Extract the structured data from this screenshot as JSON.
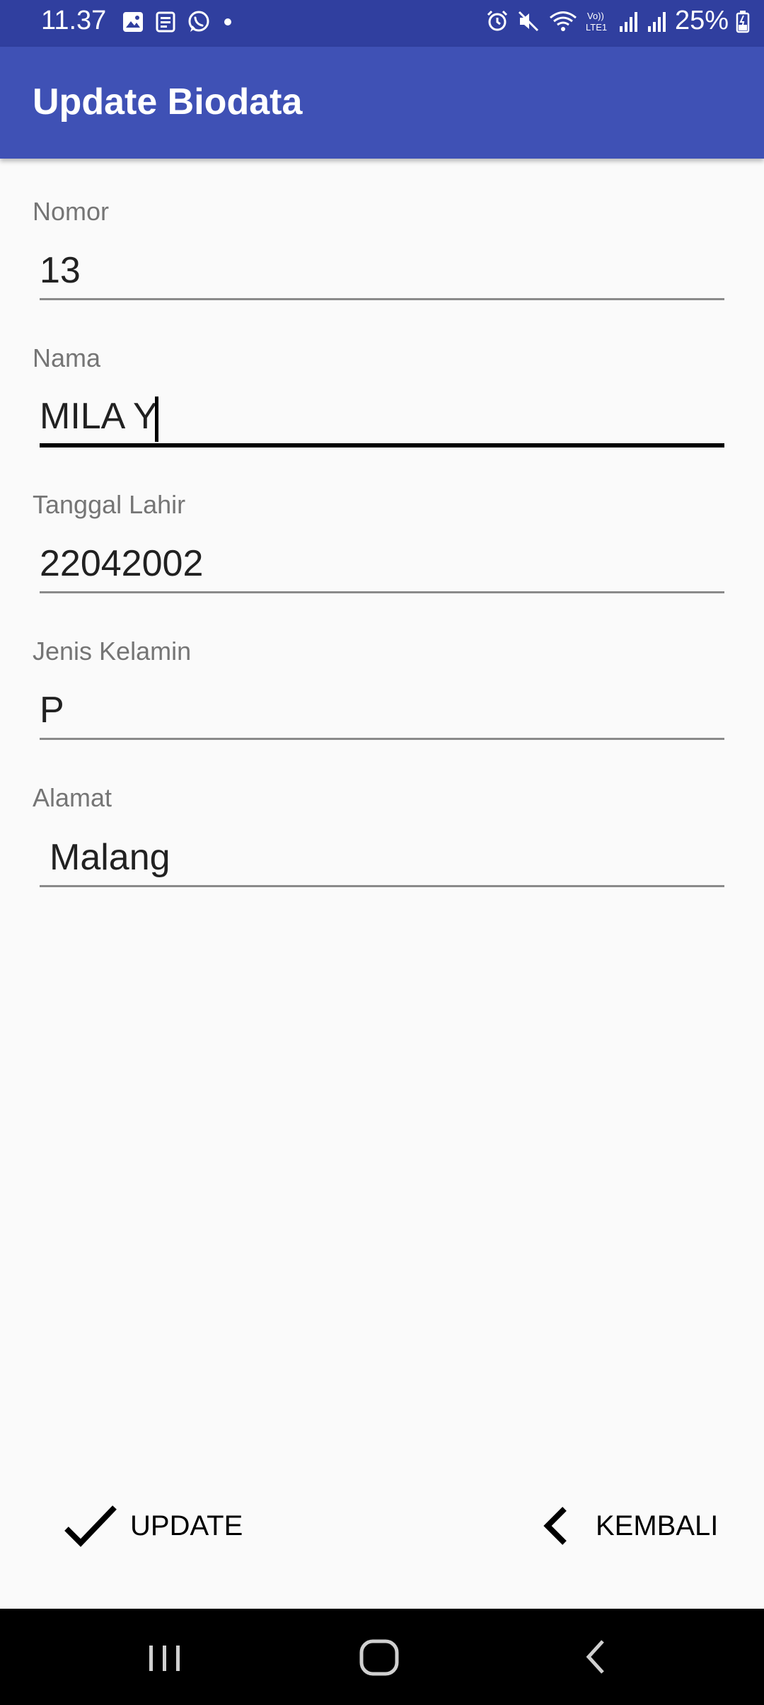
{
  "status_bar": {
    "time": "11.37",
    "battery": "25%",
    "left_icons": [
      "image-icon",
      "news-icon",
      "whatsapp-icon",
      "dot-icon"
    ],
    "right_icons": [
      "alarm-icon",
      "mute-icon",
      "wifi-icon",
      "volte-icon",
      "signal-icon",
      "signal-icon-2",
      "battery-icon"
    ]
  },
  "app_bar": {
    "title": "Update Biodata"
  },
  "form": {
    "nomor": {
      "label": "Nomor",
      "value": "13"
    },
    "nama": {
      "label": "Nama",
      "value": "MILA Y"
    },
    "tanggal_lahir": {
      "label": "Tanggal Lahir",
      "value": "22042002"
    },
    "jenis_kelamin": {
      "label": "Jenis Kelamin",
      "value": "P"
    },
    "alamat": {
      "label": "Alamat",
      "value": "Malang"
    }
  },
  "actions": {
    "update_label": "UPDATE",
    "kembali_label": "KEMBALI"
  },
  "colors": {
    "status_bar": "#303f9f",
    "app_bar": "#3f51b5",
    "background": "#fafafa"
  },
  "nav_icons": [
    "recents-icon",
    "home-icon",
    "back-icon"
  ]
}
